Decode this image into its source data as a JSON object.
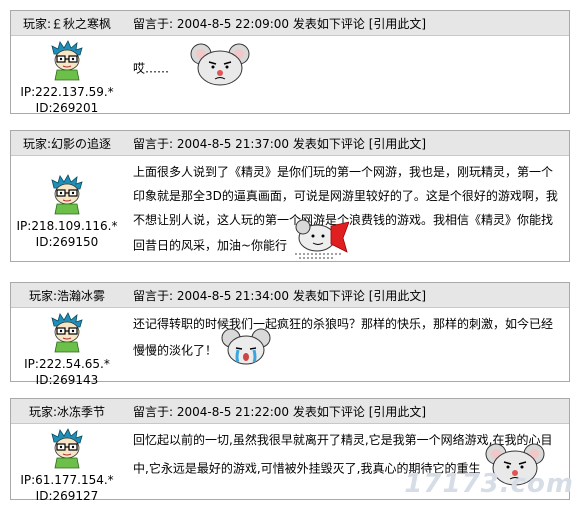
{
  "posts": [
    {
      "player": "玩家:￡秋之寒枫",
      "meta": "留言于: 2004-8-5 22:09:00 发表如下评论",
      "quote": "[引用此文]",
      "ip": "IP:222.137.59.*",
      "id": "ID:269201",
      "comment": "哎……"
    },
    {
      "player": "玩家:幻影の追逐",
      "meta": "留言于: 2004-8-5 21:37:00 发表如下评论",
      "quote": "[引用此文]",
      "ip": "IP:218.109.116.*",
      "id": "ID:269150",
      "comment": "上面很多人说到了《精灵》是你们玩的第一个网游，我也是，刚玩精灵，第一个印象就是那全3D的逼真画面，可说是网游里较好的了。这是个很好的游戏啊，我不想让别人说，这人玩的第一个网游是个浪费钱的游戏。我相信《精灵》你能找回昔日的风采，加油~你能行"
    },
    {
      "player": "玩家:浩瀚冰雾",
      "meta": "留言于: 2004-8-5 21:34:00 发表如下评论",
      "quote": "[引用此文]",
      "ip": "IP:222.54.65.*",
      "id": "ID:269143",
      "comment": "还记得转职的时候我们一起疯狂的杀狼吗？那样的快乐，那样的刺激，如今已经慢慢的淡化了！"
    },
    {
      "player": "玩家:冰冻季节",
      "meta": "留言于: 2004-8-5 21:22:00 发表如下评论",
      "quote": "[引用此文]",
      "ip": "IP:61.177.154.*",
      "id": "ID:269127",
      "comment": "回忆起以前的一切,虽然我很早就离开了精灵,它是我第一个网络游戏,在我的心目中,它永远是最好的游戏,可惜被外挂毁灭了,我真心的期待它的重生"
    }
  ],
  "watermark": "17173.com"
}
